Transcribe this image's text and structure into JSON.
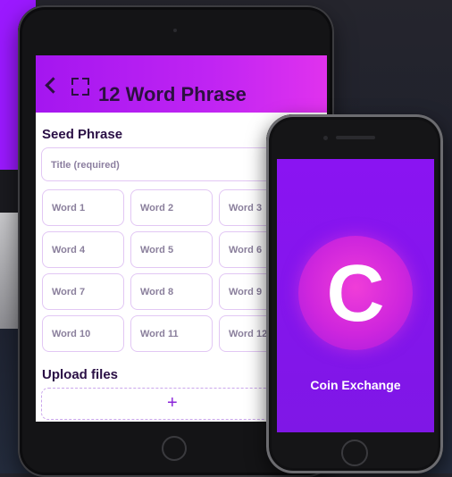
{
  "tablet_app": {
    "header": {
      "title": "12 Word Phrase"
    },
    "seed_section": {
      "label": "Seed Phrase",
      "title_placeholder": "Title (required)"
    },
    "words": [
      "Word 1",
      "Word 2",
      "Word 3",
      "Word 4",
      "Word 5",
      "Word 6",
      "Word 7",
      "Word 8",
      "Word 9",
      "Word 10",
      "Word 11",
      "Word 12"
    ],
    "upload_section": {
      "label": "Upload files",
      "add_symbol": "+"
    }
  },
  "phone_app": {
    "logo_letter": "C",
    "app_name": "Coin Exchange"
  },
  "colors": {
    "accent": "#a416f0",
    "accent_pink": "#e032ee",
    "phone_bg": "#8a14f2",
    "text_dark": "#2a0f45"
  },
  "icons": [
    "back-icon",
    "scan-icon",
    "plus-icon",
    "coin-logo"
  ]
}
